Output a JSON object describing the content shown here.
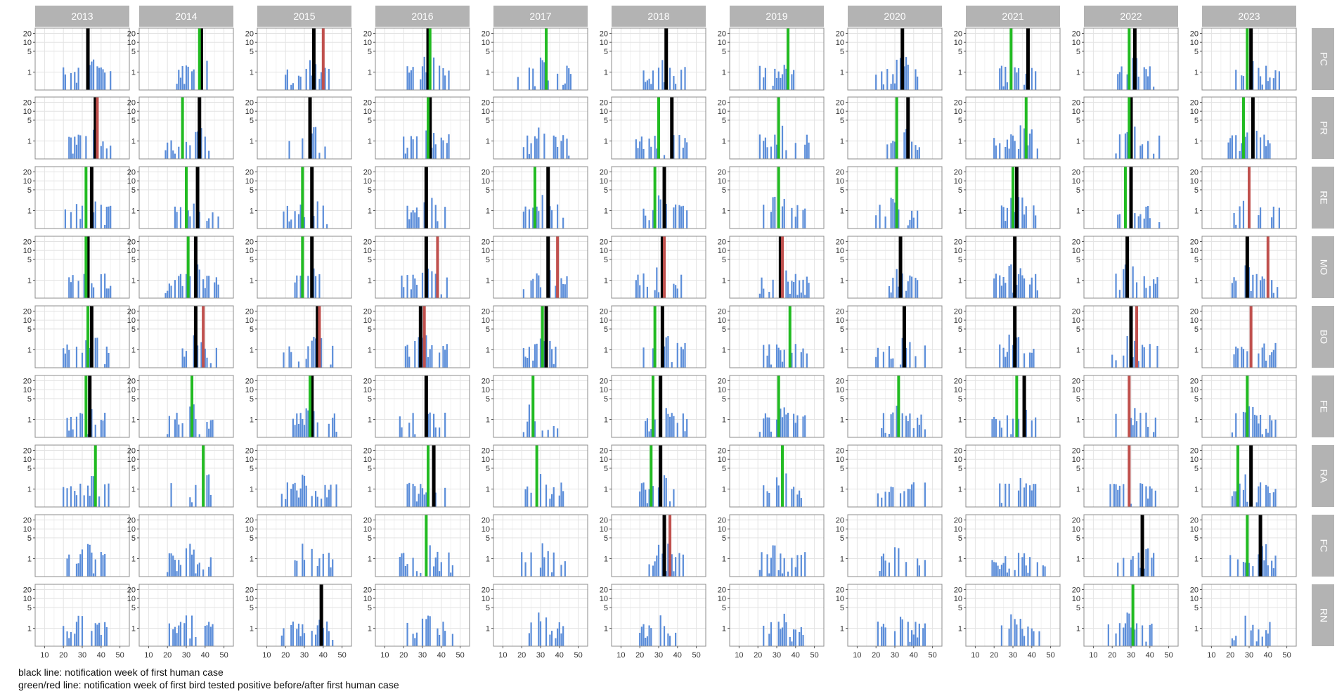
{
  "chart_data": {
    "type": "bar",
    "title": "",
    "xlabel": "",
    "ylabel": "",
    "facet_columns": [
      "2013",
      "2014",
      "2015",
      "2016",
      "2017",
      "2018",
      "2019",
      "2020",
      "2021",
      "2022",
      "2023"
    ],
    "facet_rows": [
      "PC",
      "PR",
      "RE",
      "MO",
      "BO",
      "FE",
      "RA",
      "FC",
      "RN"
    ],
    "x_ticks": [
      "10",
      "20",
      "30",
      "40",
      "50"
    ],
    "xlim": [
      5,
      55
    ],
    "y_scale": "log",
    "y_ticks": [
      "1",
      "5",
      "10",
      "20"
    ],
    "ylim": [
      0.25,
      30
    ],
    "grid": true,
    "line_colors": {
      "human": "#000000",
      "bird_before": "#22bb22",
      "bird_after": "#c0504d"
    },
    "bar_color": "#5b8dd9",
    "strip_color": "#b3b3b3",
    "lines": {
      "PC": [
        [
          33,
          null,
          null
        ],
        [
          38,
          37,
          null
        ],
        [
          35,
          null,
          40
        ],
        [
          33,
          34,
          null
        ],
        [
          null,
          33,
          null
        ],
        [
          34,
          null,
          null
        ],
        [
          null,
          36,
          null
        ],
        [
          34,
          null,
          null
        ],
        [
          38,
          29,
          null
        ],
        [
          32,
          29,
          null
        ],
        [
          31,
          29,
          null
        ]
      ],
      "PR": [
        [
          37,
          null,
          38
        ],
        [
          37,
          28,
          null
        ],
        [
          33,
          null,
          null
        ],
        [
          34,
          33,
          null
        ],
        [
          null,
          null,
          null
        ],
        [
          37,
          30,
          null
        ],
        [
          null,
          31,
          null
        ],
        [
          37,
          31,
          null
        ],
        [
          null,
          37,
          null
        ],
        [
          30,
          29,
          null
        ],
        [
          32,
          27,
          null
        ]
      ],
      "RE": [
        [
          35,
          32,
          null
        ],
        [
          36,
          30,
          null
        ],
        [
          34,
          29,
          null
        ],
        [
          32,
          null,
          null
        ],
        [
          34,
          27,
          null
        ],
        [
          33,
          28,
          null
        ],
        [
          null,
          31,
          null
        ],
        [
          null,
          31,
          null
        ],
        [
          32,
          30,
          null
        ],
        [
          30,
          27,
          null
        ],
        [
          null,
          null,
          30
        ]
      ],
      "MO": [
        [
          33,
          32,
          null
        ],
        [
          35,
          31,
          null
        ],
        [
          34,
          29,
          null
        ],
        [
          32,
          null,
          38
        ],
        [
          34,
          null,
          39
        ],
        [
          32,
          null,
          33
        ],
        [
          32,
          null,
          33
        ],
        [
          33,
          null,
          null
        ],
        [
          31,
          null,
          null
        ],
        [
          28,
          null,
          null
        ],
        [
          29,
          null,
          40
        ]
      ],
      "BO": [
        [
          35,
          33,
          null
        ],
        [
          35,
          null,
          39
        ],
        [
          37,
          null,
          38
        ],
        [
          29,
          null,
          31
        ],
        [
          33,
          31,
          null
        ],
        [
          32,
          28,
          null
        ],
        [
          null,
          37,
          null
        ],
        [
          35,
          null,
          null
        ],
        [
          31,
          null,
          null
        ],
        [
          30,
          null,
          33
        ],
        [
          null,
          null,
          31
        ]
      ],
      "FE": [
        [
          34,
          32,
          null
        ],
        [
          null,
          33,
          null
        ],
        [
          34,
          33,
          null
        ],
        [
          32,
          null,
          null
        ],
        [
          null,
          26,
          null
        ],
        [
          31,
          27,
          null
        ],
        [
          null,
          31,
          null
        ],
        [
          null,
          32,
          null
        ],
        [
          36,
          32,
          null
        ],
        [
          null,
          null,
          29
        ],
        [
          null,
          29,
          null
        ]
      ],
      "RA": [
        [
          null,
          37,
          null
        ],
        [
          null,
          39,
          null
        ],
        [
          null,
          null,
          null
        ],
        [
          36,
          33,
          null
        ],
        [
          null,
          28,
          null
        ],
        [
          31,
          26,
          null
        ],
        [
          null,
          33,
          null
        ],
        [
          null,
          null,
          null
        ],
        [
          null,
          null,
          null
        ],
        [
          null,
          null,
          29
        ],
        [
          31,
          24,
          null
        ]
      ],
      "FC": [
        [
          null,
          null,
          null
        ],
        [
          null,
          null,
          null
        ],
        [
          null,
          null,
          null
        ],
        [
          null,
          32,
          null
        ],
        [
          null,
          null,
          null
        ],
        [
          33,
          null,
          36
        ],
        [
          null,
          null,
          null
        ],
        [
          null,
          null,
          null
        ],
        [
          null,
          null,
          null
        ],
        [
          36,
          null,
          null
        ],
        [
          36,
          29,
          null
        ]
      ],
      "RN": [
        [
          null,
          null,
          null
        ],
        [
          null,
          null,
          null
        ],
        [
          39,
          null,
          null
        ],
        [
          null,
          null,
          null
        ],
        [
          null,
          null,
          null
        ],
        [
          null,
          null,
          null
        ],
        [
          null,
          null,
          null
        ],
        [
          null,
          null,
          null
        ],
        [
          null,
          null,
          null
        ],
        [
          null,
          31,
          null
        ],
        [
          null,
          null,
          null
        ]
      ]
    },
    "legend_lines": [
      "black line: notification week of first human case",
      "green/red line: notification week of first bird tested positive before/after first human case"
    ]
  }
}
